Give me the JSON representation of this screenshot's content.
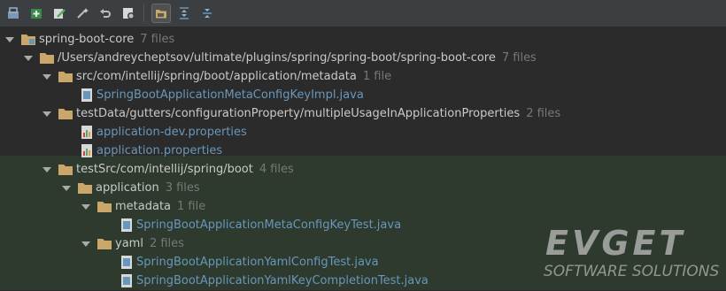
{
  "toolbar": {
    "icons": [
      "module-icon",
      "add-icon",
      "edit-icon",
      "magic-wand-icon",
      "undo-icon",
      "settings-icon",
      "group-by-directory-icon",
      "expand-all-icon",
      "collapse-all-icon"
    ]
  },
  "tree": {
    "root": {
      "label": "spring-boot-core",
      "count": "7 files"
    },
    "path": {
      "label": "/Users/andreycheptsov/ultimate/plugins/spring/spring-boot/spring-boot-core",
      "count": "7 files"
    },
    "src": {
      "label": "src/com/intellij/spring/boot/application/metadata",
      "count": "1 file"
    },
    "src_file": {
      "label": "SpringBootApplicationMetaConfigKeyImpl.java"
    },
    "testdata": {
      "label": "testData/gutters/configurationProperty/multipleUsageInApplicationProperties",
      "count": "2 files"
    },
    "testdata_file1": {
      "label": "application-dev.properties"
    },
    "testdata_file2": {
      "label": "application.properties"
    },
    "testsrc": {
      "label": "testSrc/com/intellij/spring/boot",
      "count": "4 files"
    },
    "application": {
      "label": "application",
      "count": "3 files"
    },
    "metadata": {
      "label": "metadata",
      "count": "1 file"
    },
    "metadata_file": {
      "label": "SpringBootApplicationMetaConfigKeyTest.java"
    },
    "yaml": {
      "label": "yaml",
      "count": "2 files"
    },
    "yaml_file1": {
      "label": "SpringBootApplicationYamlConfigTest.java"
    },
    "yaml_file2": {
      "label": "SpringBootApplicationYamlKeyCompletionTest.java"
    }
  },
  "watermark": {
    "brand": "EVGET",
    "tagline": "SOFTWARE SOLUTIONS"
  },
  "colors": {
    "background": "#2b2b2b",
    "test_region": "#2d3a2d",
    "file_link": "#6897bb",
    "folder": "#c9a76b"
  }
}
